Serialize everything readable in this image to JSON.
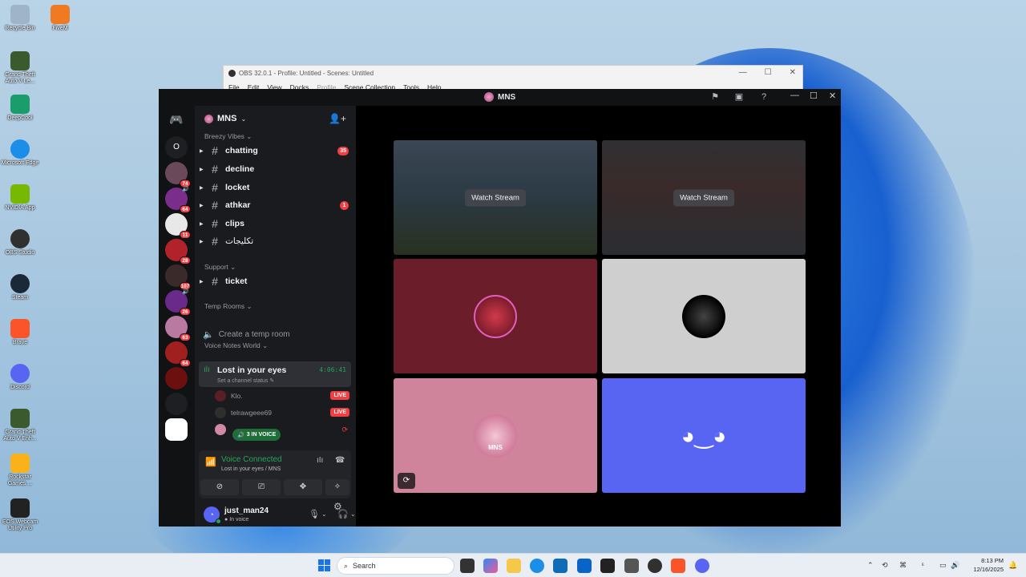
{
  "desktop": {
    "icons": [
      {
        "label": "Recycle Bin",
        "color": "#9fb4c8"
      },
      {
        "label": "FiveM",
        "color": "#f07a22"
      },
      {
        "label": "Grand Theft Auto V Le...",
        "color": "#3b5a2e"
      },
      {
        "label": "DeepCool",
        "color": "#1a9d6b"
      },
      {
        "label": "Microsoft Edge",
        "color": "#1d8ee8"
      },
      {
        "label": "NVIDIA App",
        "color": "#76b900"
      },
      {
        "label": "OBS Studio",
        "color": "#303030"
      },
      {
        "label": "Steam",
        "color": "#1b2838"
      },
      {
        "label": "Brave",
        "color": "#fb542b"
      },
      {
        "label": "Discord",
        "color": "#5865f2"
      },
      {
        "label": "Grand Theft Auto V Enh...",
        "color": "#3b5a2e"
      },
      {
        "label": "Rockstar Games ...",
        "color": "#f9b21a"
      },
      {
        "label": "EOS Webcam Utility Pro",
        "color": "#222222"
      }
    ]
  },
  "obs": {
    "title": "OBS 32.0.1 - Profile: Untitled - Scenes: Untitled",
    "menu": [
      "File",
      "Edit",
      "View",
      "Docks",
      "Profile",
      "Scene Collection",
      "Tools",
      "Help"
    ],
    "disabled_menu": "Profile",
    "ctrls": [
      "—",
      "☐",
      "✕"
    ]
  },
  "discord": {
    "window_title": "MNS",
    "server_name": "MNS",
    "rail": [
      {
        "glyph": "O",
        "badge": "",
        "color": "#1e1f22"
      },
      {
        "glyph": "",
        "badge": "74",
        "color": "#6a4a5a"
      },
      {
        "glyph": "",
        "badge": "64",
        "color": "#7a2d8a"
      },
      {
        "glyph": "",
        "badge": "11",
        "color": "#e8e8e8"
      },
      {
        "glyph": "",
        "badge": "28",
        "color": "#b2222a"
      },
      {
        "glyph": "",
        "badge": "107",
        "color": "#3a2a2a"
      },
      {
        "glyph": "",
        "badge": "26",
        "color": "#6a2a8a"
      },
      {
        "glyph": "",
        "badge": "63",
        "color": "#b87aa0"
      },
      {
        "glyph": "",
        "badge": "64",
        "color": "#a02020"
      },
      {
        "glyph": "",
        "badge": "",
        "color": "#6b0f0f"
      },
      {
        "glyph": "",
        "badge": "",
        "color": "#1e1f22"
      },
      {
        "glyph": "",
        "badge": "",
        "color": "#ffffff"
      }
    ],
    "categories": {
      "breezy": "Breezy Vibes",
      "support": "Support",
      "temp": "Temp Rooms",
      "voice": "Voice Notes World"
    },
    "channels": [
      {
        "name": "chatting",
        "badge": "35"
      },
      {
        "name": "decline",
        "badge": ""
      },
      {
        "name": "locket",
        "badge": ""
      },
      {
        "name": "athkar",
        "badge": "1"
      },
      {
        "name": "clips",
        "badge": ""
      },
      {
        "name": "تكليجات",
        "badge": ""
      }
    ],
    "support_channel": "ticket",
    "temp_room_label": "Create a temp room",
    "voice_channel": {
      "name": "Lost in your eyes",
      "status": "Set a channel status",
      "timer": "4:06:41"
    },
    "voice_users": [
      {
        "name": "Klo.",
        "live": "LIVE",
        "color": "#5a1f24"
      },
      {
        "name": "telrawgeee69",
        "live": "LIVE",
        "color": "#2e2e2e"
      },
      {
        "name": "",
        "live": "",
        "color": "#d08aa6"
      },
      {
        "name": "just_man24",
        "live": "",
        "color": "#5865f2"
      }
    ],
    "in_voice_pill": "3 IN VOICE",
    "voice_connected": {
      "title": "Voice Connected",
      "subtitle": "Lost in your eyes / MNS"
    },
    "user": {
      "name": "just_man24",
      "status": "In voice"
    },
    "tiles": {
      "watch_label": "Watch Stream",
      "mns_label": "MNS"
    }
  },
  "taskbar": {
    "search_placeholder": "Search",
    "time": "8:13 PM",
    "date": "12/16/2025"
  }
}
